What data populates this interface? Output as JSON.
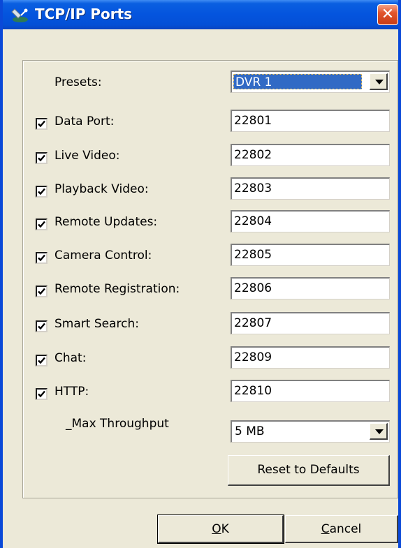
{
  "window": {
    "title": "TCP/IP Ports",
    "close_glyph": "✕",
    "title_icon": "satellite-icon"
  },
  "presets": {
    "label": "Presets:",
    "value": "DVR 1"
  },
  "ports": [
    {
      "label": "Data Port:",
      "value": "22801",
      "checked": true
    },
    {
      "label": "Live Video:",
      "value": "22802",
      "checked": true
    },
    {
      "label": "Playback Video:",
      "value": "22803",
      "checked": true
    },
    {
      "label": "Remote Updates:",
      "value": "22804",
      "checked": true
    },
    {
      "label": "Camera Control:",
      "value": "22805",
      "checked": true
    },
    {
      "label": "Remote Registration:",
      "value": "22806",
      "checked": true
    },
    {
      "label": "Smart Search:",
      "value": "22807",
      "checked": true
    },
    {
      "label": "Chat:",
      "value": "22809",
      "checked": true
    },
    {
      "label": "HTTP:",
      "value": "22810",
      "checked": true
    }
  ],
  "throughput": {
    "label": "_Max Throughput",
    "value": "5 MB"
  },
  "buttons": {
    "reset": "Reset to Defaults",
    "ok_mnemonic": "O",
    "ok_rest": "K",
    "cancel_mnemonic": "C",
    "cancel_rest": "ancel"
  },
  "colors": {
    "titlebar": "#0454de",
    "face": "#ece9d8",
    "selection": "#316ac5",
    "close": "#e2552c"
  }
}
